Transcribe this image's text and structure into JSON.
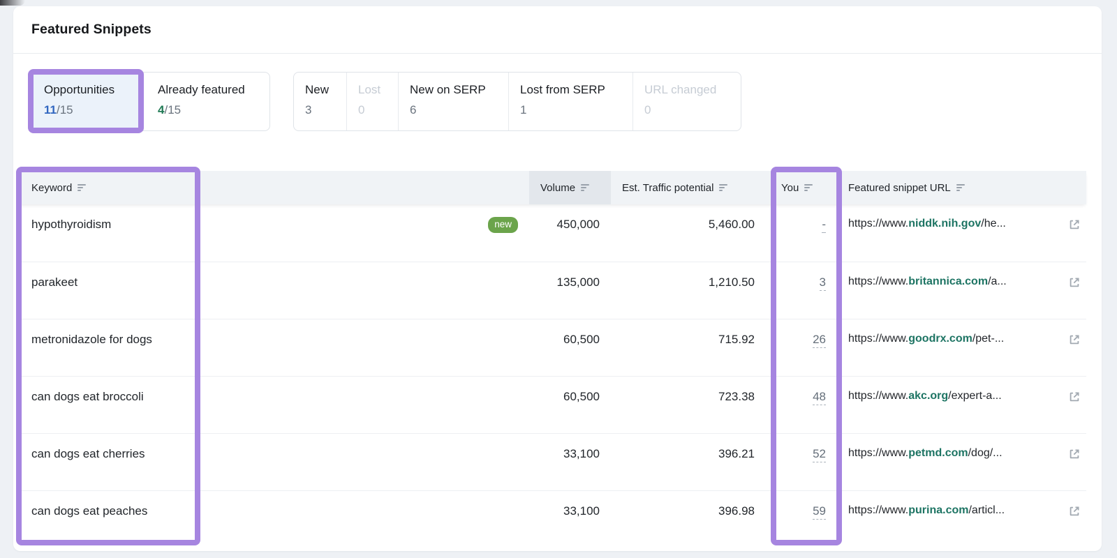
{
  "header": {
    "title": "Featured Snippets"
  },
  "tabs": [
    {
      "label": "Opportunities",
      "count": "11",
      "total": "/15"
    },
    {
      "label": "Already featured",
      "count": "4",
      "total": "/15"
    }
  ],
  "filters": [
    {
      "label": "New",
      "count": "3",
      "disabled": false
    },
    {
      "label": "Lost",
      "count": "0",
      "disabled": true
    },
    {
      "label": "New on SERP",
      "count": "6",
      "disabled": false
    },
    {
      "label": "Lost from SERP",
      "count": "1",
      "disabled": false
    },
    {
      "label": "URL changed",
      "count": "0",
      "disabled": true
    }
  ],
  "table": {
    "headers": {
      "keyword": "Keyword",
      "volume": "Volume",
      "traffic": "Est. Traffic potential",
      "you": "You",
      "url": "Featured snippet URL"
    },
    "rows": [
      {
        "keyword": "hypothyroidism",
        "badge": "new",
        "volume": "450,000",
        "traffic": "5,460.00",
        "you": "-",
        "url_prefix": "https://www.",
        "url_domain": "niddk.nih.gov",
        "url_path": "/he..."
      },
      {
        "keyword": "parakeet",
        "badge": "",
        "volume": "135,000",
        "traffic": "1,210.50",
        "you": "3",
        "url_prefix": "https://www.",
        "url_domain": "britannica.com",
        "url_path": "/a..."
      },
      {
        "keyword": "metronidazole for dogs",
        "badge": "",
        "volume": "60,500",
        "traffic": "715.92",
        "you": "26",
        "url_prefix": "https://www.",
        "url_domain": "goodrx.com",
        "url_path": "/pet-..."
      },
      {
        "keyword": "can dogs eat broccoli",
        "badge": "",
        "volume": "60,500",
        "traffic": "723.38",
        "you": "48",
        "url_prefix": "https://www.",
        "url_domain": "akc.org",
        "url_path": "/expert-a..."
      },
      {
        "keyword": "can dogs eat cherries",
        "badge": "",
        "volume": "33,100",
        "traffic": "396.21",
        "you": "52",
        "url_prefix": "https://www.",
        "url_domain": "petmd.com",
        "url_path": "/dog/..."
      },
      {
        "keyword": "can dogs eat peaches",
        "badge": "",
        "volume": "33,100",
        "traffic": "396.98",
        "you": "59",
        "url_prefix": "https://www.",
        "url_domain": "purina.com",
        "url_path": "/articl..."
      }
    ]
  },
  "colors": {
    "annotation_purple": "#a685e0",
    "badge_green": "#6ba44b",
    "domain_teal": "#1d7463",
    "count_blue": "#3066c0",
    "count_green": "#207a55",
    "selected_tab_bg": "#ebf2fa",
    "header_row_bg": "#f0f3f6",
    "volume_header_bg": "#e3e7ec"
  }
}
